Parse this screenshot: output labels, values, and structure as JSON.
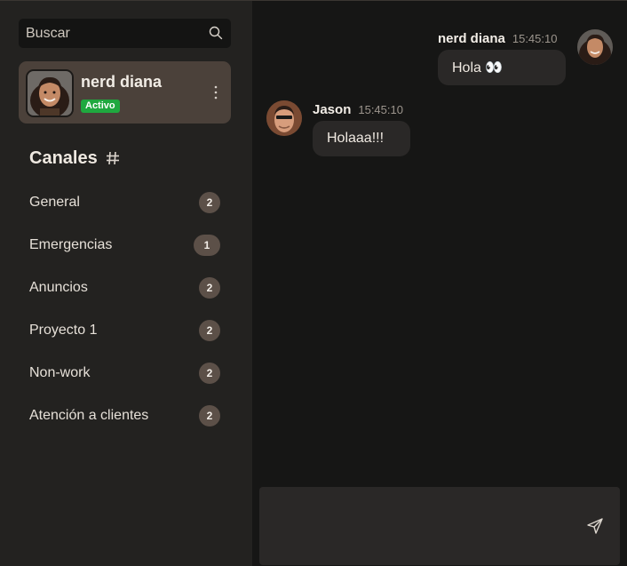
{
  "search": {
    "placeholder": "Buscar",
    "icon": "search-icon"
  },
  "profile": {
    "name": "nerd diana",
    "status": "Activo",
    "status_color": "#1fa83f",
    "menu_icon": "more-vertical-icon"
  },
  "channels": {
    "title": "Canales",
    "title_icon": "hash-icon",
    "items": [
      {
        "label": "General",
        "count": "2"
      },
      {
        "label": "Emergencias",
        "count": "1"
      },
      {
        "label": "Anuncios",
        "count": "2"
      },
      {
        "label": "Proyecto 1",
        "count": "2"
      },
      {
        "label": "Non-work",
        "count": "2"
      },
      {
        "label": "Atención a clientes",
        "count": "2"
      }
    ]
  },
  "messages": [
    {
      "author": "nerd diana",
      "time": "15:45:10",
      "text": "Hola 👀",
      "align": "right"
    },
    {
      "author": "Jason",
      "time": "15:45:10",
      "text": "Holaaa!!!",
      "align": "left"
    }
  ],
  "composer": {
    "placeholder": "",
    "send_icon": "send-icon"
  },
  "colors": {
    "sidebar": "#232220",
    "main": "#161615",
    "accent_profile": "#4b413a",
    "badge": "#5c5048"
  }
}
